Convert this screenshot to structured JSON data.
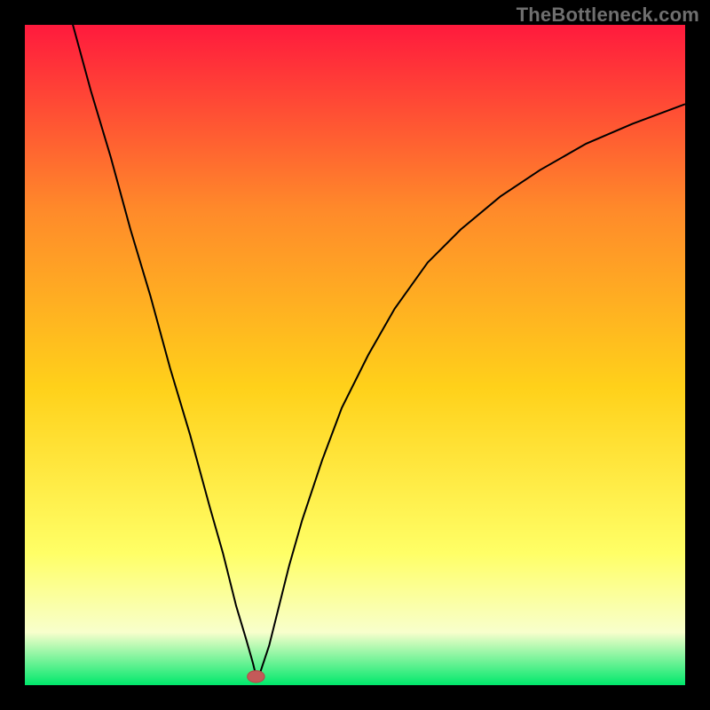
{
  "watermark": "TheBottleneck.com",
  "colors": {
    "frame": "#000000",
    "grad_top": "#ff1a3d",
    "grad_mid_upper": "#ff8a2a",
    "grad_mid": "#ffd11a",
    "grad_low1": "#ffff66",
    "grad_low2": "#f8ffcc",
    "grad_bottom": "#00e86b",
    "curve": "#000000",
    "marker_fill": "#c45a59",
    "marker_stroke": "#b54a49"
  },
  "chart_data": {
    "type": "line",
    "title": "",
    "xlabel": "",
    "ylabel": "",
    "x_range": [
      0,
      100
    ],
    "y_range": [
      0,
      100
    ],
    "series": [
      {
        "name": "bottleneck-curve",
        "x": [
          7,
          10,
          13,
          16,
          19,
          22,
          25,
          28,
          30,
          32,
          33.5,
          34.5,
          35,
          35.5,
          36,
          37,
          38,
          39,
          40,
          42,
          45,
          48,
          52,
          56,
          61,
          66,
          72,
          78,
          85,
          92,
          100
        ],
        "y": [
          101,
          90,
          80,
          69,
          59,
          48,
          38,
          27,
          20,
          12,
          7,
          3.5,
          1.5,
          1.5,
          3,
          6,
          10,
          14,
          18,
          25,
          34,
          42,
          50,
          57,
          64,
          69,
          74,
          78,
          82,
          85,
          88
        ]
      }
    ],
    "marker": {
      "x": 35,
      "y": 1.3,
      "rx": 1.3,
      "ry": 0.9
    },
    "gradient_stops": [
      {
        "offset": 0,
        "color": "#ff1a3d"
      },
      {
        "offset": 0.28,
        "color": "#ff8a2a"
      },
      {
        "offset": 0.55,
        "color": "#ffd11a"
      },
      {
        "offset": 0.8,
        "color": "#ffff66"
      },
      {
        "offset": 0.92,
        "color": "#f8ffcc"
      },
      {
        "offset": 1.0,
        "color": "#00e86b"
      }
    ]
  }
}
